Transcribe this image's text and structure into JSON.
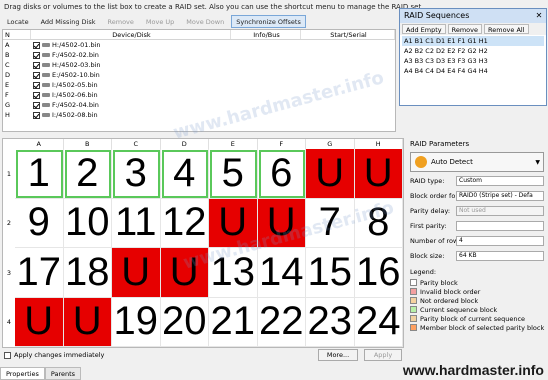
{
  "hint": "Drag disks or volumes to the list box to create a RAID set. Also you can use the shortcut menu to manage the RAID set.",
  "toolbar": [
    "Locate",
    "Add Missing Disk",
    "Remove",
    "Move Up",
    "Move Down",
    "Synchronize Offsets"
  ],
  "disk_table": {
    "headers": [
      "N",
      "Device/Disk",
      "Info/Bus",
      "Start/Serial"
    ],
    "rows": [
      {
        "n": "A",
        "device": "H:/4502-01.bin"
      },
      {
        "n": "B",
        "device": "F:/4502-02.bin"
      },
      {
        "n": "C",
        "device": "H:/4502-03.bin"
      },
      {
        "n": "D",
        "device": "E:/4502-10.bin"
      },
      {
        "n": "E",
        "device": "I:/4502-05.bin"
      },
      {
        "n": "F",
        "device": "I:/4502-06.bin"
      },
      {
        "n": "G",
        "device": "F:/4502-04.bin"
      },
      {
        "n": "H",
        "device": "I:/4502-08.bin"
      }
    ]
  },
  "seq_panel": {
    "title": "RAID Sequences",
    "close": "✕",
    "buttons": [
      "Add Empty",
      "Remove",
      "Remove All"
    ],
    "rows": [
      "A1 B1 C1 D1 E1 F1 G1 H1",
      "A2 B2 C2 D2 E2 F2 G2 H2",
      "A3 B3 C3 D3 E3 F3 G3 H3",
      "A4 B4 C4 D4 E4 F4 G4 H4"
    ]
  },
  "grid": {
    "columns": [
      "A",
      "B",
      "C",
      "D",
      "E",
      "F",
      "G",
      "H"
    ],
    "rows": [
      "1",
      "2",
      "3",
      "4"
    ],
    "cells": [
      [
        "1",
        "2",
        "3",
        "4",
        "5",
        "6",
        "U",
        "U"
      ],
      [
        "9",
        "10",
        "11",
        "12",
        "U",
        "U",
        "7",
        "8"
      ],
      [
        "17",
        "18",
        "U",
        "U",
        "13",
        "14",
        "15",
        "16"
      ],
      [
        "U",
        "U",
        "19",
        "20",
        "21",
        "22",
        "23",
        "24"
      ]
    ],
    "parity_color": "#e60000",
    "current_sequence_color": "#5ac85a"
  },
  "apply_immediately": "Apply changes immediately",
  "more_button": "More...",
  "apply_button": "Apply",
  "bottom_tabs": [
    "Properties",
    "Parents"
  ],
  "props": {
    "title": "RAID Parameters",
    "auto_detect": "Auto Detect",
    "fields": [
      {
        "label": "RAID type:",
        "value": "Custom"
      },
      {
        "label": "Block order fo:",
        "value": "RAID0 (Stripe set) - Defa"
      },
      {
        "label": "Parity delay:",
        "value": "Not used"
      },
      {
        "label": "First parity:",
        "value": ""
      },
      {
        "label": "Number of rows:",
        "value": "4"
      },
      {
        "label": "Block size:",
        "value": "64 KB"
      }
    ],
    "legend_title": "Legend:",
    "legend": [
      {
        "label": "Parity block",
        "color": "#ffffff"
      },
      {
        "label": "Invalid block order",
        "color": "#f4a0a0"
      },
      {
        "label": "Not ordered block",
        "color": "#f5d2a0"
      },
      {
        "label": "Current sequence block",
        "color": "#b8f0a8"
      },
      {
        "label": "Parity block of current sequence",
        "color": "#f0d0a0"
      },
      {
        "label": "Member block of selected parity block",
        "color": "#ffa060"
      }
    ]
  },
  "watermark": "www.hardmaster.info"
}
